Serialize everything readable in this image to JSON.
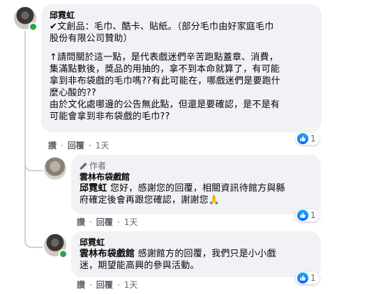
{
  "comments": [
    {
      "author": "邱霓虹",
      "lines_p1": [
        "✔文創品：毛巾、酷卡、貼紙。（部分毛巾由好家庭毛巾",
        "股份有限公司贊助）"
      ],
      "lines_p2": [
        "↑請問關於這一點，是代表戲迷們辛苦跑點蓋章、消費，",
        "集滿點數後，獎品的用抽的，拿不到本命就算了，有可能",
        "拿到非布袋戲的毛巾嗎??有此可能在，哪戲迷們是要跑什",
        "麼心酸的??",
        "由於文化處哪邊的公告無此點，但還是要確認，是不是有",
        "可能會拿到非布袋戲的毛巾??"
      ],
      "action_like": "讚",
      "action_reply": "回覆",
      "timestamp": "1天",
      "reaction_count": "1"
    },
    {
      "author_tag": "作者",
      "author": "雲林布袋戲館",
      "mention": "邱霓虹",
      "line1": " 您好，感謝您的回覆，相關資訊待館方與縣",
      "line2": "府確定後會再跟您確認，謝謝您",
      "emoji": "🙏",
      "action_like": "讚",
      "action_reply": "回覆",
      "timestamp": "1天",
      "reaction_count": "1"
    },
    {
      "author": "邱霓虹",
      "mention": "雲林布袋戲館",
      "line1": " 感謝館方的回覆，我們只是小小戲",
      "line2": "迷，期望能高興的參與活動。",
      "action_like": "讚",
      "action_reply": "回覆",
      "timestamp": "1天",
      "reaction_count": "1"
    }
  ],
  "colors": {
    "bubble": "#f0f2f5",
    "like_blue": "#0866ff",
    "online_green": "#31a24c",
    "meta_gray": "#65676b"
  }
}
